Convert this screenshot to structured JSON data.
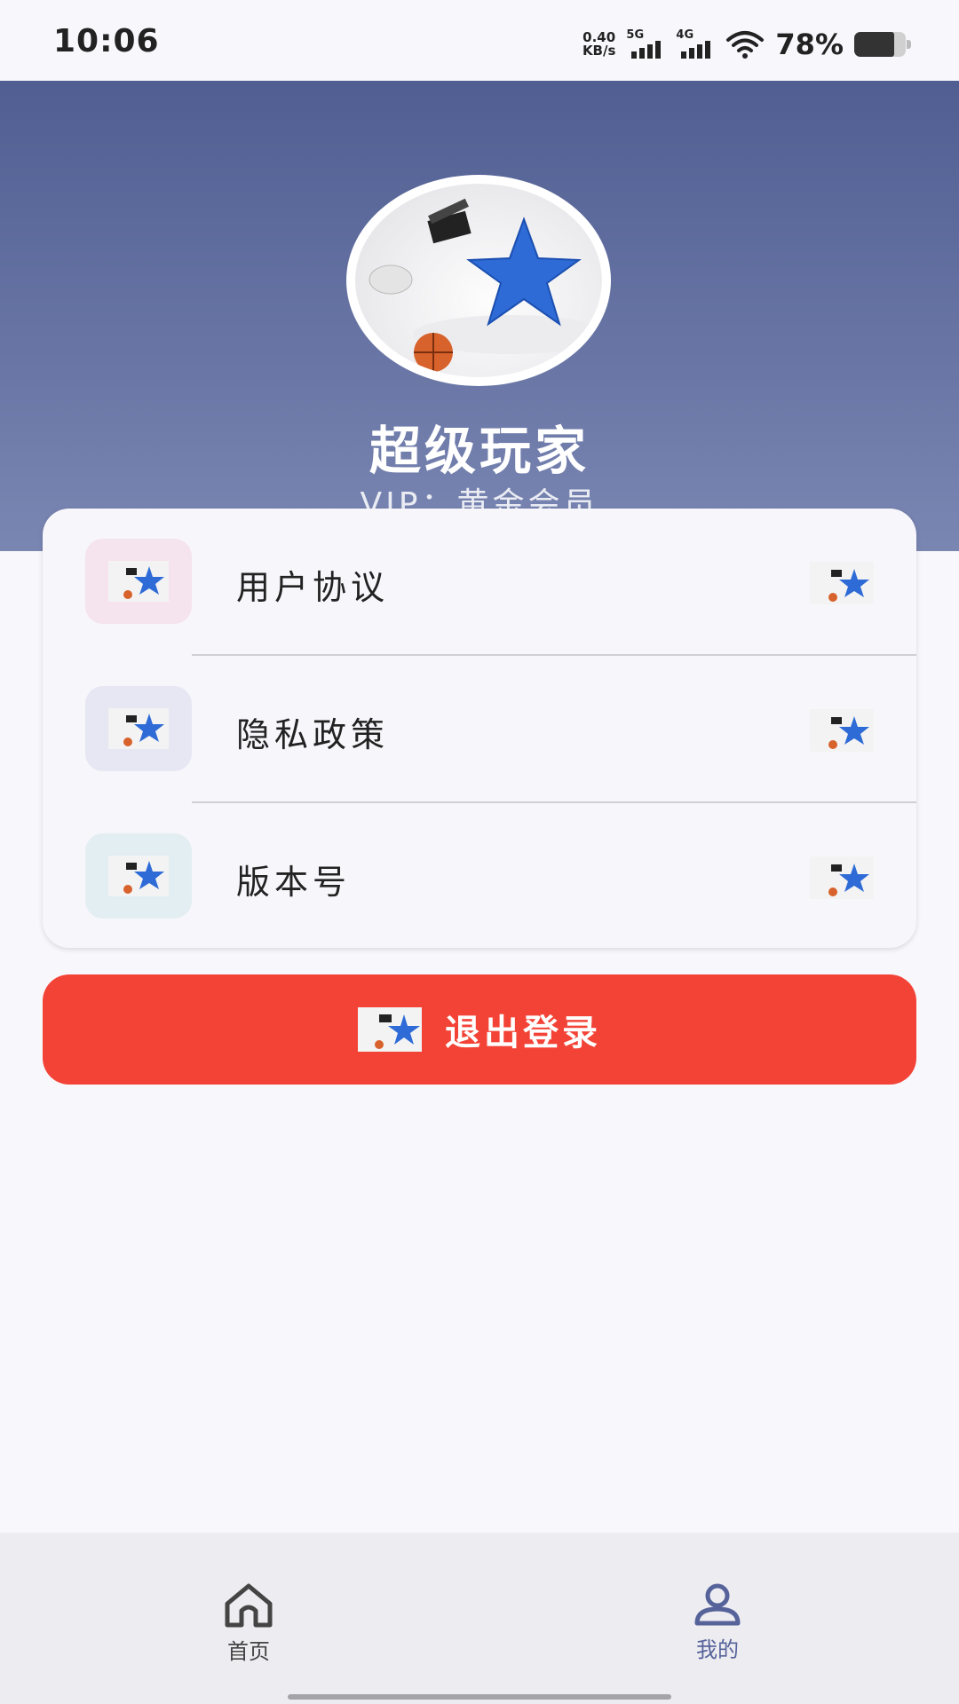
{
  "status_bar": {
    "time": "10:06",
    "speed_value": "0.40",
    "speed_unit": "KB/s",
    "net1": "5G",
    "net2": "4G",
    "battery_pct": "78%",
    "battery_level": 0.78
  },
  "profile": {
    "name": "超级玩家",
    "vip": "VIP：黄金会员"
  },
  "menu": {
    "items": [
      {
        "label": "用户协议",
        "icon_bg": "#f5e3ee"
      },
      {
        "label": "隐私政策",
        "icon_bg": "#e7e7f3"
      },
      {
        "label": "版本号",
        "icon_bg": "#e3eef2"
      }
    ]
  },
  "logout": {
    "label": "退出登录",
    "color": "#f34336"
  },
  "bottom_nav": {
    "home_label": "首页",
    "mine_label": "我的",
    "active_color": "#56639a"
  },
  "icons": {
    "app_image": "star-icon",
    "home": "home-icon",
    "user": "user-icon"
  }
}
